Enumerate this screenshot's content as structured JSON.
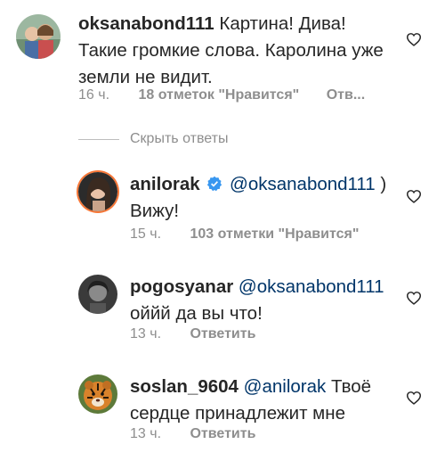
{
  "comments": [
    {
      "username": "oksanabond111",
      "text": "Картина!  Дива! Такие громкие слова. Каролина уже земли не видит.",
      "time": "16 ч.",
      "likes": "18 отметок \"Нравится\"",
      "reply": "Отв..."
    },
    {
      "username": "anilorak",
      "verified": true,
      "mention": "@oksanabond111",
      "text": ") Вижу!",
      "time": "15 ч.",
      "likes": "103 отметки \"Нравится\""
    },
    {
      "username": "pogosyanar",
      "mention": "@oksanabond111",
      "text": "оййй да вы что!",
      "time": "13 ч.",
      "reply": "Ответить"
    },
    {
      "username": "soslan_9604",
      "mention": "@anilorak",
      "text": "Твоё сердце принадлежит мне",
      "time": "13 ч.",
      "reply": "Ответить"
    }
  ],
  "hide_replies_label": "Скрыть ответы",
  "colors": {
    "text": "#262626",
    "meta": "#8e8e8e",
    "mention": "#003569",
    "verified": "#3897f0"
  },
  "icons": {
    "like": "heart-outline-icon",
    "verified": "verified-badge-icon"
  }
}
